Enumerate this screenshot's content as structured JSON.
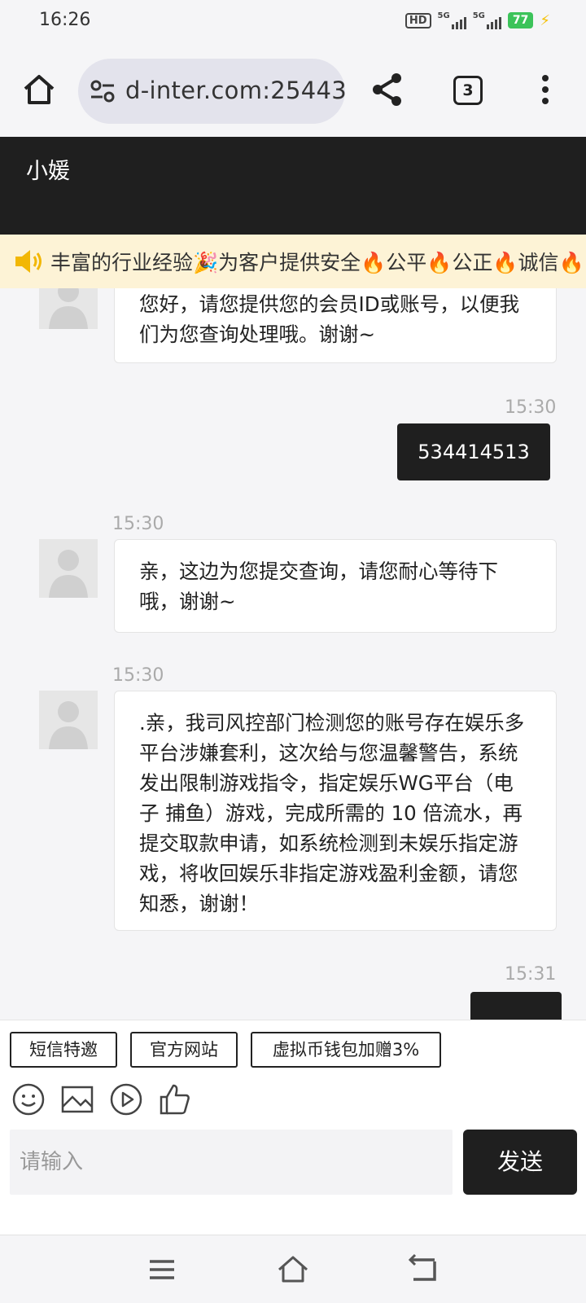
{
  "status_bar": {
    "time": "16:26",
    "hd_label": "HD",
    "network_1": "5G",
    "network_2": "5G",
    "battery": "77"
  },
  "browser": {
    "url": "d-inter.com:25443",
    "tab_count": "3"
  },
  "chat": {
    "agent_name": "小媛",
    "marquee": "丰富的行业经验🎉为客户提供安全🔥公平🔥公正🔥诚信🔥",
    "messages": [
      {
        "direction": "incoming",
        "time": "",
        "text": "您好，请您提供您的会员ID或账号，以便我们为您查询处理哦。谢谢~"
      },
      {
        "direction": "outgoing",
        "time": "15:30",
        "text": "534414513"
      },
      {
        "direction": "incoming",
        "time": "15:30",
        "text": "亲，这边为您提交查询，请您耐心等待下哦，谢谢~"
      },
      {
        "direction": "incoming",
        "time": "15:30",
        "text": ".亲，我司风控部门检测您的账号存在娱乐多平台涉嫌套利，这次给与您温馨警告，系统发出限制游戏指令，指定娱乐WG平台（电子 捕鱼）游戏，完成所需的 10 倍流水，再提交取款申请，如系统检测到未娱乐指定游戏，将收回娱乐非指定游戏盈利金额，请您知悉，谢谢！"
      },
      {
        "direction": "outgoing",
        "time": "15:31",
        "text": ""
      }
    ]
  },
  "quick_replies": [
    "短信特邀",
    "官方网站",
    "虚拟币钱包加赠3%"
  ],
  "toolbar_icons": [
    "emoji-icon",
    "image-icon",
    "video-icon",
    "thumbs-up-icon"
  ],
  "input": {
    "placeholder": "请输入",
    "send_label": "发送"
  },
  "nav_icons": [
    "menu-icon",
    "home-icon",
    "back-icon"
  ]
}
